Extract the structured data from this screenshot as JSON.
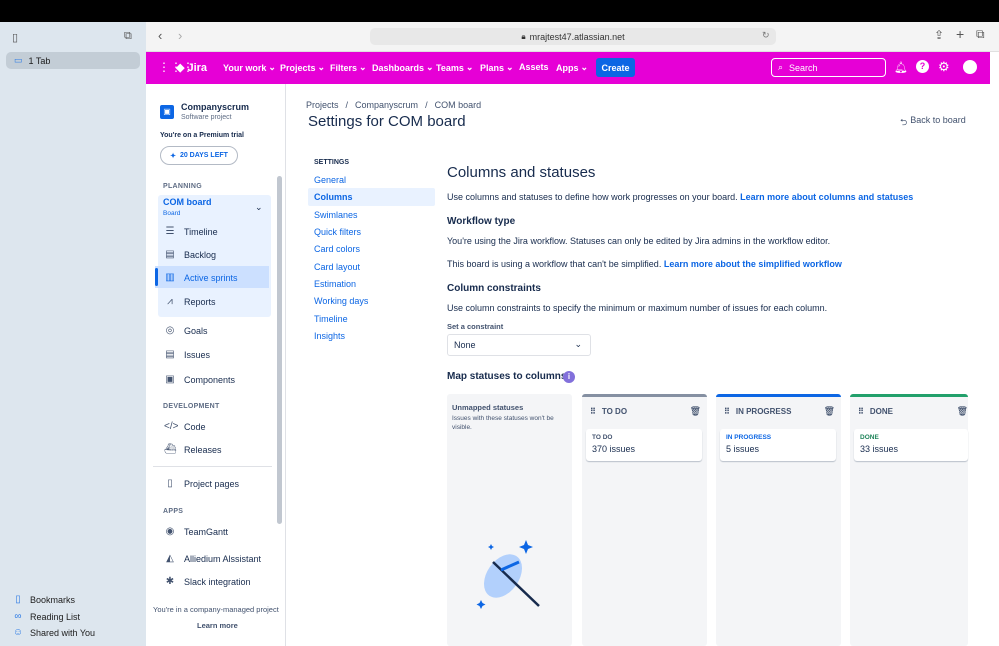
{
  "safari": {
    "tab_label": "1 Tab",
    "url": "mrajtest47.atlassian.net",
    "bottom": [
      "Bookmarks",
      "Reading List",
      "Shared with You"
    ]
  },
  "nav": {
    "logo": "Jira",
    "items": [
      "Your work",
      "Projects",
      "Filters",
      "Dashboards",
      "Teams",
      "Plans",
      "Assets",
      "Apps"
    ],
    "create": "Create",
    "search_placeholder": "Search"
  },
  "project": {
    "name": "Companyscrum",
    "type": "Software project",
    "trial_text": "You're on a Premium trial",
    "days_left": "20 DAYS LEFT",
    "planning_title": "PLANNING",
    "board_name": "COM board",
    "board_sub": "Board",
    "planning_items": [
      "Timeline",
      "Backlog",
      "Active sprints",
      "Reports"
    ],
    "other_items": [
      "Goals",
      "Issues",
      "Components"
    ],
    "development_title": "DEVELOPMENT",
    "development_items": [
      "Code",
      "Releases"
    ],
    "project_pages": "Project pages",
    "apps_title": "APPS",
    "apps": [
      "TeamGantt",
      "Alliedium Alssistant",
      "Slack integration"
    ],
    "footer_text": "You're in a company-managed project",
    "learn_more": "Learn more"
  },
  "main": {
    "breadcrumbs": [
      "Projects",
      "Companyscrum",
      "COM board"
    ],
    "title": "Settings for COM board",
    "back": "Back to board",
    "settings_title": "SETTINGS",
    "settings_items": [
      "General",
      "Columns",
      "Swimlanes",
      "Quick filters",
      "Card colors",
      "Card layout",
      "Estimation",
      "Working days",
      "Timeline",
      "Insights"
    ],
    "heading": "Columns and statuses",
    "intro": "Use columns and statuses to define how work progresses on your board.",
    "intro_link": "Learn more about columns and statuses",
    "workflow_heading": "Workflow type",
    "workflow_text": "You're using the Jira workflow. Statuses can only be edited by Jira admins in the workflow editor.",
    "simplify_text": "This board is using a workflow that can't be simplified.",
    "simplify_link": "Learn more about the simplified workflow",
    "constraints_heading": "Column constraints",
    "constraints_text": "Use column constraints to specify the minimum or maximum number of issues for each column.",
    "constraint_label": "Set a constraint",
    "constraint_value": "None",
    "map_heading": "Map statuses to columns",
    "unmapped_title": "Unmapped statuses",
    "unmapped_desc": "Issues with these statuses won't be visible.",
    "columns": [
      {
        "name": "TO DO",
        "status": "TO DO",
        "count": "370 issues",
        "color": "#42526e"
      },
      {
        "name": "IN PROGRESS",
        "status": "IN PROGRESS",
        "count": "5 issues",
        "color": "#0c66e4"
      },
      {
        "name": "DONE",
        "status": "DONE",
        "count": "33 issues",
        "color": "#1f845a"
      }
    ]
  },
  "colors": {
    "nav": "#e600d6",
    "link": "#0c66e4",
    "create": "#0c66e4"
  }
}
